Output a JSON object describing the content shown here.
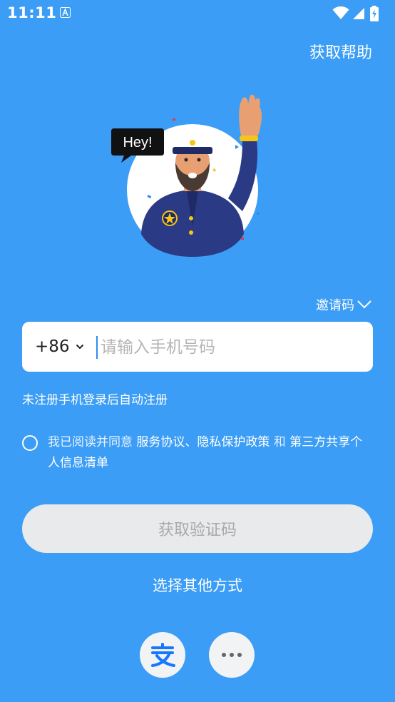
{
  "status_bar": {
    "time": "11:11"
  },
  "header": {
    "help_label": "获取帮助"
  },
  "illustration": {
    "speech_bubble": "Hey!"
  },
  "invite": {
    "label": "邀请码"
  },
  "phone": {
    "country_code": "+86",
    "placeholder": "请输入手机号码",
    "value": ""
  },
  "hint": "未注册手机登录后自动注册",
  "agreement": {
    "prefix": "我已阅读并同意 ",
    "link_terms": "服务协议、隐私保护政策",
    "conjunction": " 和 ",
    "link_third_party": "第三方共享个人信息清单",
    "checked": false
  },
  "get_code_label": "获取验证码",
  "other_methods_label": "选择其他方式",
  "alt_login": {
    "alipay_icon": "alipay-logo-icon",
    "more_icon": "more-dots-icon"
  },
  "colors": {
    "background": "#3b9df5",
    "button_disabled_bg": "#e9eaec",
    "button_disabled_text": "#a9a9a9",
    "alipay_blue": "#1677ff"
  }
}
